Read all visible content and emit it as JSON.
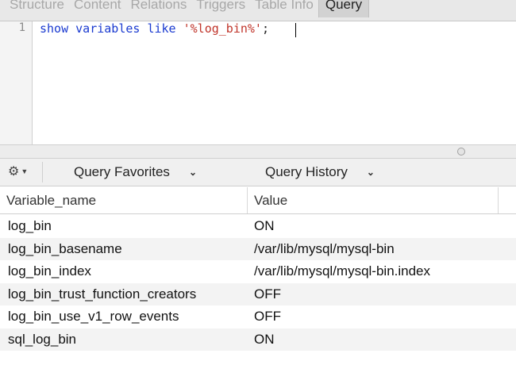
{
  "tabs": [
    {
      "label": "Structure"
    },
    {
      "label": "Content"
    },
    {
      "label": "Relations"
    },
    {
      "label": "Triggers"
    },
    {
      "label": "Table Info"
    },
    {
      "label": "Query",
      "active": true
    }
  ],
  "editor": {
    "line_number": "1",
    "code_keyword": "show variables like ",
    "code_string": "'%log_bin%'",
    "code_end": ";"
  },
  "toolbar": {
    "gear_icon": "gear-icon",
    "favorites_label": "Query Favorites",
    "history_label": "Query History"
  },
  "results": {
    "columns": [
      "Variable_name",
      "Value"
    ],
    "rows": [
      {
        "name": "log_bin",
        "value": "ON"
      },
      {
        "name": "log_bin_basename",
        "value": "/var/lib/mysql/mysql-bin"
      },
      {
        "name": "log_bin_index",
        "value": "/var/lib/mysql/mysql-bin.index"
      },
      {
        "name": "log_bin_trust_function_creators",
        "value": "OFF"
      },
      {
        "name": "log_bin_use_v1_row_events",
        "value": "OFF"
      },
      {
        "name": "sql_log_bin",
        "value": "ON"
      }
    ]
  },
  "colors": {
    "keyword": "#1a3ad0",
    "string": "#c0342a",
    "row_alt": "#f3f3f3"
  }
}
